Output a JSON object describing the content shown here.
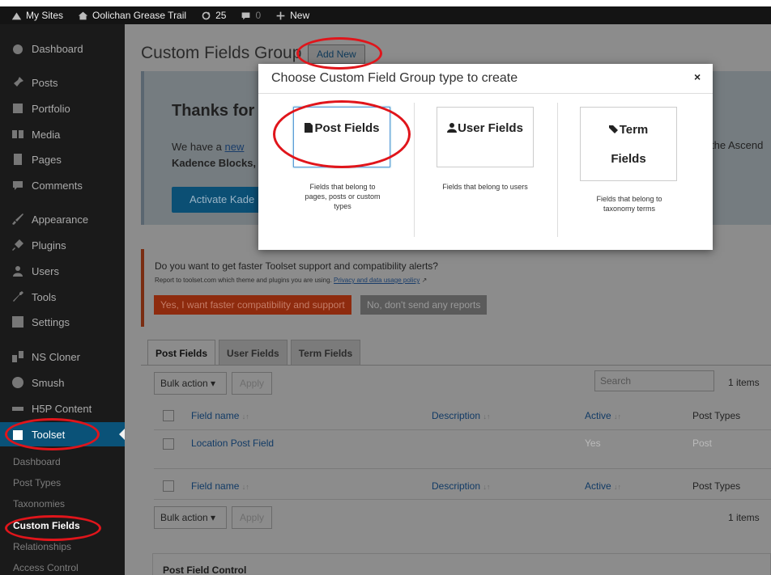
{
  "adminbar": {
    "my_sites": "My Sites",
    "site_name": "Oolichan Grease Trail",
    "updates_count": "25",
    "comments_count": "0",
    "new_label": "New"
  },
  "sidebar": {
    "items": [
      {
        "label": "Dashboard",
        "icon": "dashboard-icon"
      },
      {
        "label": "Posts",
        "icon": "pin-icon"
      },
      {
        "label": "Portfolio",
        "icon": "portfolio-icon"
      },
      {
        "label": "Media",
        "icon": "media-icon"
      },
      {
        "label": "Pages",
        "icon": "pages-icon"
      },
      {
        "label": "Comments",
        "icon": "comments-icon"
      },
      {
        "label": "Appearance",
        "icon": "brush-icon"
      },
      {
        "label": "Plugins",
        "icon": "plug-icon"
      },
      {
        "label": "Users",
        "icon": "users-icon"
      },
      {
        "label": "Tools",
        "icon": "wrench-icon"
      },
      {
        "label": "Settings",
        "icon": "settings-icon"
      },
      {
        "label": "NS Cloner",
        "icon": "cloner-icon"
      },
      {
        "label": "Smush",
        "icon": "smush-icon"
      },
      {
        "label": "H5P Content",
        "icon": "h5p-icon"
      },
      {
        "label": "Toolset",
        "icon": "toolset-icon"
      }
    ],
    "submenu": [
      "Dashboard",
      "Post Types",
      "Taxonomies",
      "Custom Fields",
      "Relationships",
      "Access Control"
    ]
  },
  "main": {
    "title": "Custom Fields Group",
    "add_new": "Add New",
    "kadence": {
      "title": "Thanks for",
      "text_prefix": "We have a ",
      "text_link": "new",
      "text_line2": "Kadence Blocks,",
      "text_right": "the Ascend",
      "button": "Activate Kade"
    },
    "toolset_notice": {
      "question": "Do you want to get faster Toolset support and compatibility alerts?",
      "small_prefix": "Report to toolset.com which theme and plugins you are using.",
      "small_link": "Privacy and data usage policy",
      "yes_button": "Yes, I want faster compatibility and support",
      "no_button": "No, don't send any reports"
    },
    "tabs": [
      "Post Fields",
      "User Fields",
      "Term Fields"
    ],
    "bulk_action": "Bulk action",
    "apply": "Apply",
    "search_placeholder": "Search",
    "items_count": "1 items",
    "columns": [
      "Field name",
      "Description",
      "Active",
      "Post Types"
    ],
    "rows": [
      {
        "name": "Location Post Field",
        "description": "",
        "active": "Yes",
        "post_types": "Post"
      }
    ],
    "post_field_control": "Post Field Control"
  },
  "modal": {
    "title": "Choose Custom Field Group type to create",
    "close": "×",
    "options": [
      {
        "label": "Post Fields",
        "icon": "document-icon",
        "desc_1": "Fields that belong to",
        "desc_2": "pages, posts or custom",
        "desc_3": "types"
      },
      {
        "label": "User Fields",
        "icon": "user-icon",
        "desc_1": "Fields that belong to users"
      },
      {
        "label_1": "Term",
        "label_2": "Fields",
        "icon": "tags-icon",
        "desc_1": "Fields that belong to",
        "desc_2": "taxonomy terms"
      }
    ]
  },
  "colors": {
    "annotation_red": "#e0151b",
    "sidebar_active": "#0a5278",
    "modal_selected_border": "#5b9dd9"
  }
}
